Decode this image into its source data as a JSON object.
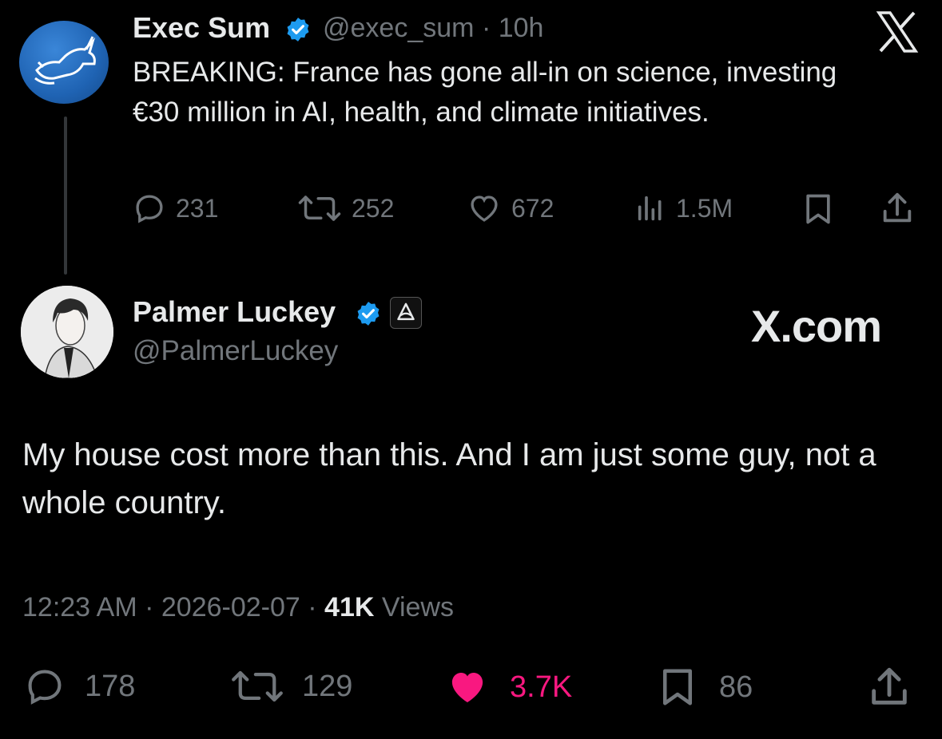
{
  "parent_tweet": {
    "name": "Exec Sum",
    "handle": "@exec_sum",
    "separator": "·",
    "time": "10h",
    "text": "BREAKING: France has gone all-in on science, investing €30 million in AI, health, and climate initiatives.",
    "replies": "231",
    "reposts": "252",
    "likes": "672",
    "views": "1.5M"
  },
  "main_tweet": {
    "name": "Palmer Luckey",
    "handle": "@PalmerLuckey",
    "text": "My house cost more than this.  And I am just some guy, not a whole country.",
    "time": "12:23 AM",
    "sep1": "·",
    "date": "2026-02-07",
    "sep2": "·",
    "views_count": "41K",
    "views_label": "Views",
    "replies": "178",
    "reposts": "129",
    "likes": "3.7K",
    "bookmarks": "86"
  },
  "watermark": "X.com",
  "icons": {
    "verified": "verified-badge-icon",
    "platform": "x-logo-icon",
    "affiliation": "affiliation-badge-icon"
  },
  "colors": {
    "background": "#000000",
    "text": "#e7e9ea",
    "muted": "#71767b",
    "verified": "#1d9bf0",
    "liked": "#f91880"
  }
}
